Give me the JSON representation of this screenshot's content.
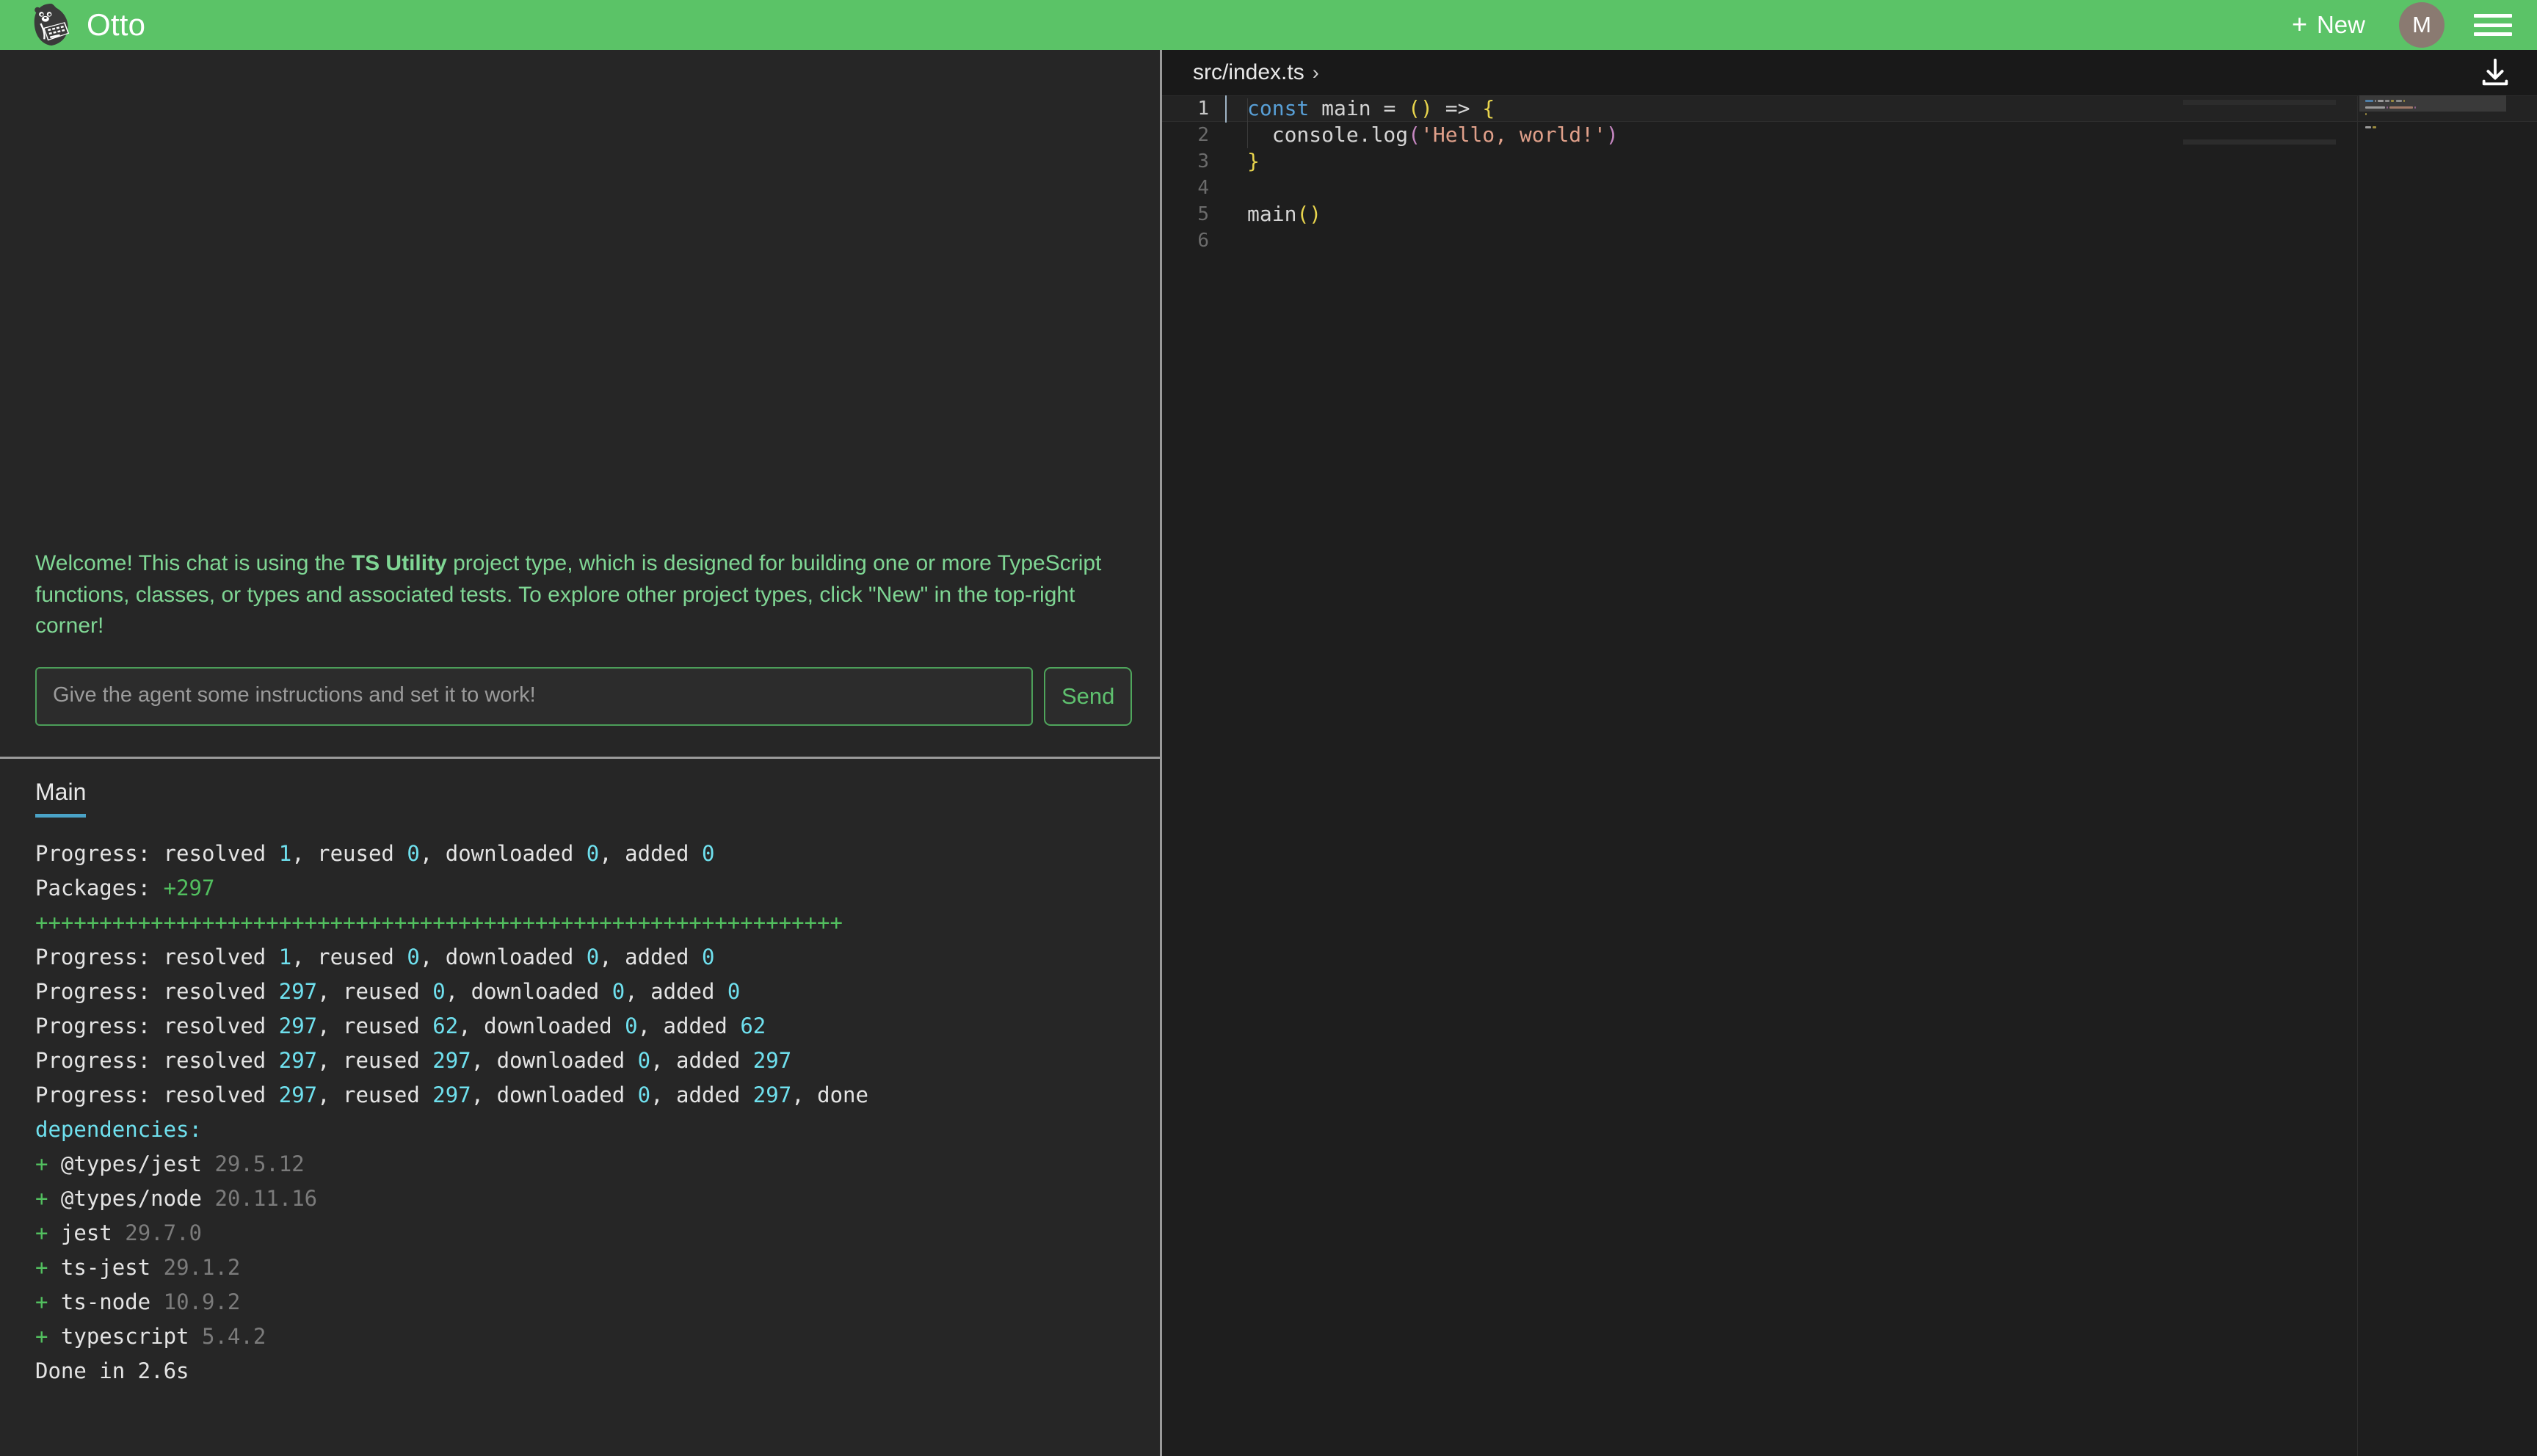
{
  "header": {
    "brand_title": "Otto",
    "logo_icon": "otter-laptop-logo",
    "new_label": "New",
    "new_plus_glyph": "+",
    "avatar_initial": "M",
    "avatar_color": "#8a7a71",
    "menu_icon": "hamburger-menu-icon",
    "background_color": "#5bc367"
  },
  "chat": {
    "welcome_prefix": "Welcome! This chat is using the ",
    "welcome_bold": "TS Utility",
    "welcome_suffix": " project type, which is designed for building one or more TypeScript functions, classes, or types and associated tests. To explore other project types, click \"New\" in the top-right corner!",
    "welcome_color": "#7fd694",
    "input_value": "",
    "input_placeholder": "Give the agent some instructions and set it to work!",
    "send_label": "Send",
    "send_color": "#5fc16f"
  },
  "terminal": {
    "tabs": [
      {
        "label": "Main",
        "active": true
      }
    ],
    "active_tab_underline_color": "#4aa3c7",
    "lines": [
      {
        "type": "progress",
        "resolved": "1",
        "reused": "0",
        "downloaded": "0",
        "added": "0",
        "done": false
      },
      {
        "type": "packages",
        "label": "Packages:",
        "value": "+297"
      },
      {
        "type": "progressbar",
        "value": "+++++++++++++++++++++++++++++++++++++++++++++++++++++++++++++++"
      },
      {
        "type": "progress",
        "resolved": "1",
        "reused": "0",
        "downloaded": "0",
        "added": "0",
        "done": false
      },
      {
        "type": "progress",
        "resolved": "297",
        "reused": "0",
        "downloaded": "0",
        "added": "0",
        "done": false
      },
      {
        "type": "progress",
        "resolved": "297",
        "reused": "62",
        "downloaded": "0",
        "added": "62",
        "done": false
      },
      {
        "type": "progress",
        "resolved": "297",
        "reused": "297",
        "downloaded": "0",
        "added": "297",
        "done": false
      },
      {
        "type": "progress",
        "resolved": "297",
        "reused": "297",
        "downloaded": "0",
        "added": "297",
        "done": true
      },
      {
        "type": "heading",
        "text": "dependencies:"
      },
      {
        "type": "dep",
        "name": "@types/jest",
        "version": "29.5.12"
      },
      {
        "type": "dep",
        "name": "@types/node",
        "version": "20.11.16"
      },
      {
        "type": "dep",
        "name": "jest",
        "version": "29.7.0"
      },
      {
        "type": "dep",
        "name": "ts-jest",
        "version": "29.1.2"
      },
      {
        "type": "dep",
        "name": "ts-node",
        "version": "10.9.2"
      },
      {
        "type": "dep",
        "name": "typescript",
        "version": "5.4.2"
      },
      {
        "type": "plain",
        "text": "Done in 2.6s"
      }
    ],
    "labels": {
      "progress_prefix": "Progress: resolved ",
      "reused": ", reused ",
      "downloaded": ", downloaded ",
      "added": ", added ",
      "done_suffix": ", done"
    }
  },
  "editor": {
    "breadcrumb_path": "src/index.ts",
    "breadcrumb_chevron": "›",
    "download_icon": "download-icon",
    "active_line": 1,
    "lines": [
      {
        "number": "1",
        "tokens": [
          {
            "t": "const",
            "c": "kw-const"
          },
          {
            "t": " ",
            "c": "kw-op"
          },
          {
            "t": "main",
            "c": "kw-id"
          },
          {
            "t": " = ",
            "c": "kw-op"
          },
          {
            "t": "()",
            "c": "kw-paren"
          },
          {
            "t": " => ",
            "c": "kw-op"
          },
          {
            "t": "{",
            "c": "kw-brace"
          }
        ]
      },
      {
        "number": "2",
        "tokens": [
          {
            "t": "  console.log",
            "c": "kw-id"
          },
          {
            "t": "(",
            "c": "kw-quote"
          },
          {
            "t": "'Hello, world!'",
            "c": "kw-str"
          },
          {
            "t": ")",
            "c": "kw-quote"
          }
        ]
      },
      {
        "number": "3",
        "tokens": [
          {
            "t": "}",
            "c": "kw-brace"
          }
        ]
      },
      {
        "number": "4",
        "tokens": []
      },
      {
        "number": "5",
        "tokens": [
          {
            "t": "main",
            "c": "kw-id"
          },
          {
            "t": "()",
            "c": "kw-paren"
          }
        ]
      },
      {
        "number": "6",
        "tokens": []
      }
    ]
  }
}
